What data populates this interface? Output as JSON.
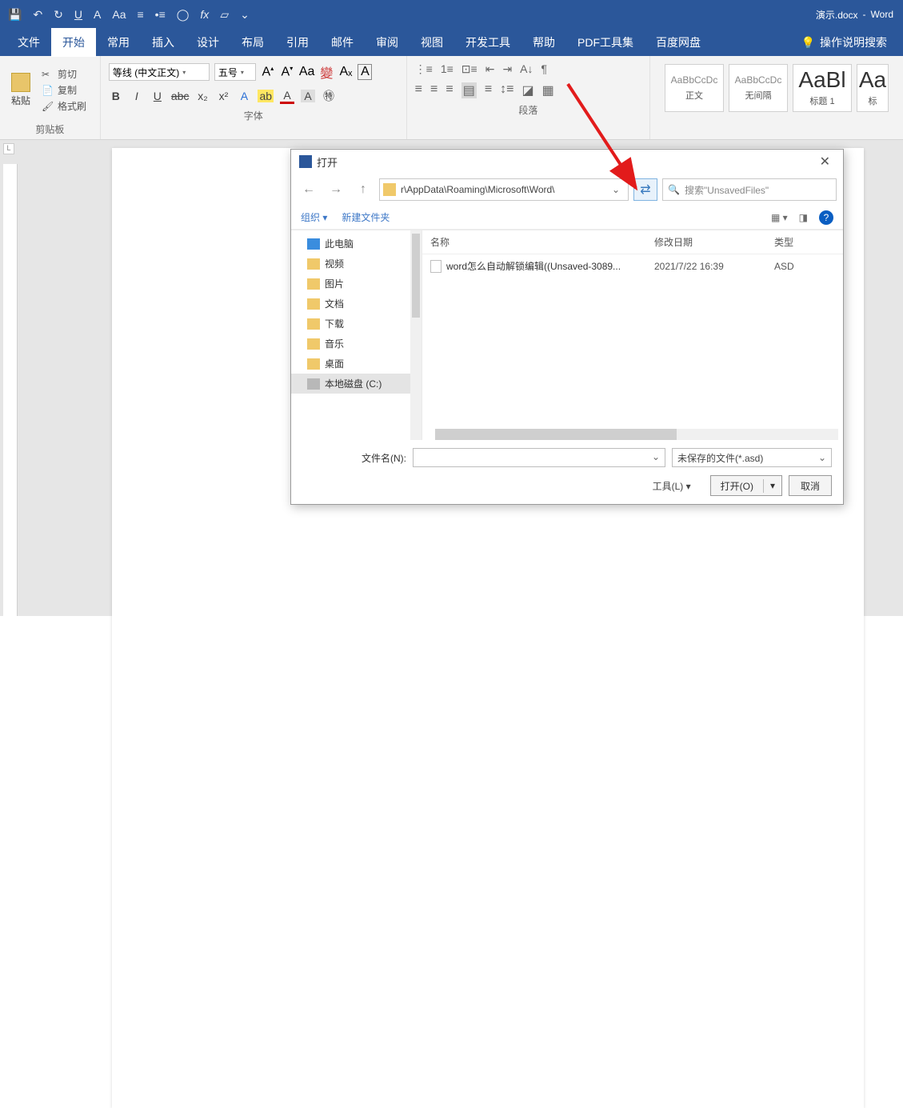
{
  "title": {
    "doc": "演示.docx",
    "app": "Word"
  },
  "qat": [
    "save",
    "undo",
    "redo",
    "U",
    "A",
    "Aa",
    "list",
    "bullet",
    "circle",
    "fx",
    "shape",
    "more"
  ],
  "tabs": {
    "items": [
      "文件",
      "开始",
      "常用",
      "插入",
      "设计",
      "布局",
      "引用",
      "邮件",
      "审阅",
      "视图",
      "开发工具",
      "帮助",
      "PDF工具集",
      "百度网盘"
    ],
    "active": 1,
    "help_hint": "操作说明搜索"
  },
  "ribbon": {
    "clipboard": {
      "paste": "粘贴",
      "cut": "剪切",
      "copy": "复制",
      "brush": "格式刷",
      "label": "剪贴板"
    },
    "font": {
      "name": "等线 (中文正文)",
      "size": "五号",
      "label": "字体"
    },
    "paragraph": {
      "label": "段落"
    },
    "styles": {
      "s1": "AaBbCcDc",
      "s1n": "正文",
      "s2": "AaBbCcDc",
      "s2n": "无间隔",
      "s3": "AaBl",
      "s3n": "标题 1",
      "s4": "Aa",
      "s4n": "标"
    }
  },
  "dialog": {
    "title": "打开",
    "path": "r\\AppData\\Roaming\\Microsoft\\Word\\",
    "search_placeholder": "搜索\"UnsavedFiles\"",
    "toolbar": {
      "org": "组织",
      "newf": "新建文件夹"
    },
    "tree": [
      "此电脑",
      "视频",
      "图片",
      "文档",
      "下载",
      "音乐",
      "桌面",
      "本地磁盘 (C:)"
    ],
    "tree_selected": 7,
    "cols": {
      "name": "名称",
      "date": "修改日期",
      "type": "类型"
    },
    "files": [
      {
        "name": "word怎么自动解锁编辑((Unsaved-3089...",
        "date": "2021/7/22 16:39",
        "type": "ASD"
      }
    ],
    "footer": {
      "fname_label": "文件名(N):",
      "filter": "未保存的文件(*.asd)",
      "tools": "工具(L)",
      "open": "打开(O)",
      "cancel": "取消"
    }
  }
}
